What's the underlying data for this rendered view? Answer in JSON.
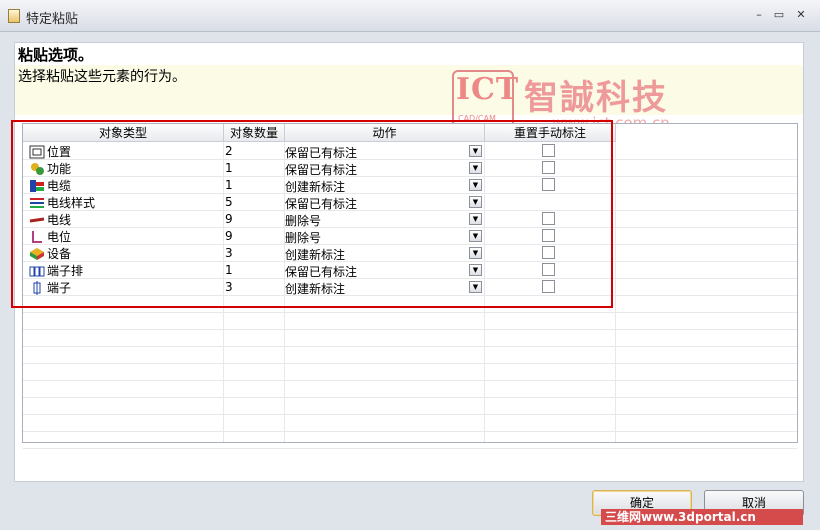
{
  "window": {
    "title": "特定粘贴",
    "controls": {
      "minimize": "–",
      "maximize": "▭",
      "close": "✕"
    }
  },
  "header": {
    "title": "粘贴选项。",
    "subtitle": "选择粘贴这些元素的行为。"
  },
  "watermark": {
    "ict": "ICT",
    "cadcam": "CAD/CAM",
    "cn": "智誠科技",
    "url": "www.ict.com.cn"
  },
  "table": {
    "columns": [
      "对象类型",
      "对象数量",
      "动作",
      "重置手动标注"
    ],
    "rows": [
      {
        "type": "位置",
        "icon": "location-icon",
        "count": "2",
        "action": "保留已有标注",
        "checkbox": true
      },
      {
        "type": "功能",
        "icon": "function-icon",
        "count": "1",
        "action": "保留已有标注",
        "checkbox": true
      },
      {
        "type": "电缆",
        "icon": "cable-icon",
        "count": "1",
        "action": "创建新标注",
        "checkbox": true
      },
      {
        "type": "电线样式",
        "icon": "wire-style-icon",
        "count": "5",
        "action": "保留已有标注",
        "checkbox": false
      },
      {
        "type": "电线",
        "icon": "wire-icon",
        "count": "9",
        "action": "删除号",
        "checkbox": true
      },
      {
        "type": "电位",
        "icon": "potential-icon",
        "count": "9",
        "action": "删除号",
        "checkbox": true
      },
      {
        "type": "设备",
        "icon": "device-icon",
        "count": "3",
        "action": "创建新标注",
        "checkbox": true
      },
      {
        "type": "端子排",
        "icon": "terminal-strip-icon",
        "count": "1",
        "action": "保留已有标注",
        "checkbox": true
      },
      {
        "type": "端子",
        "icon": "terminal-icon",
        "count": "3",
        "action": "创建新标注",
        "checkbox": true
      }
    ]
  },
  "buttons": {
    "ok": "确定",
    "cancel": "取消"
  },
  "footer_watermark": "三维网www.3dportal.cn",
  "colors": {
    "highlight_box": "#d40000",
    "header_band": "#fbfbe6"
  }
}
